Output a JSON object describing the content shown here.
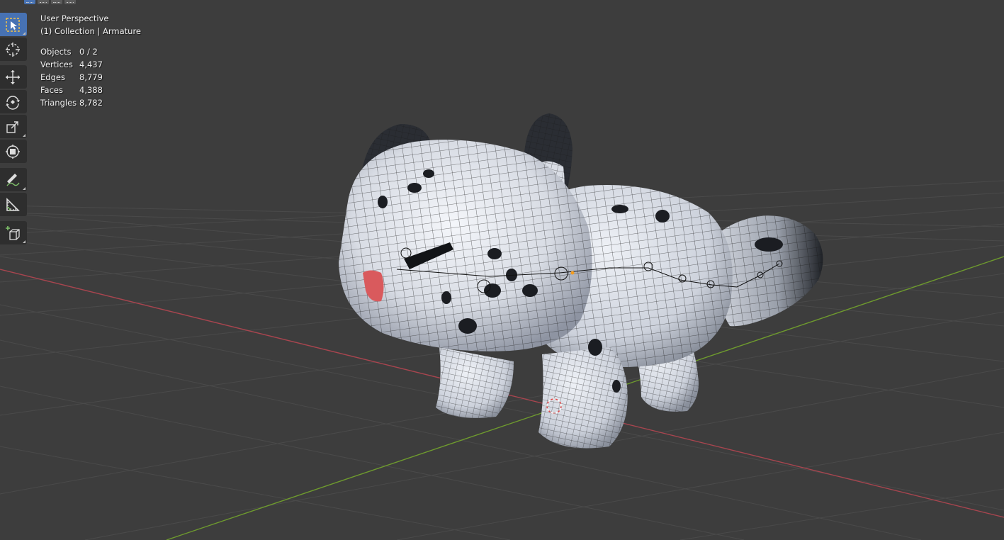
{
  "viewport": {
    "view_name": "User Perspective",
    "collection_info": "(1) Collection | Armature",
    "stats": [
      {
        "label": "Objects",
        "value": "0 / 2"
      },
      {
        "label": "Vertices",
        "value": "4,437"
      },
      {
        "label": "Edges",
        "value": "8,779"
      },
      {
        "label": "Faces",
        "value": "4,388"
      },
      {
        "label": "Triangles",
        "value": "8,782"
      }
    ]
  },
  "toolbar": {
    "tools": [
      {
        "name": "select-box",
        "icon": "select-box-icon",
        "active": true
      },
      {
        "name": "cursor",
        "icon": "cursor-icon",
        "active": false
      },
      {
        "name": "move",
        "icon": "move-icon",
        "active": false
      },
      {
        "name": "rotate",
        "icon": "rotate-icon",
        "active": false
      },
      {
        "name": "scale",
        "icon": "scale-icon",
        "active": false
      },
      {
        "name": "transform",
        "icon": "transform-icon",
        "active": false
      },
      {
        "name": "annotate",
        "icon": "annotate-icon",
        "active": false
      },
      {
        "name": "measure",
        "icon": "measure-icon",
        "active": false
      },
      {
        "name": "add-cube",
        "icon": "add-cube-icon",
        "active": false
      }
    ]
  },
  "colors": {
    "background": "#3d3d3d",
    "grid": "#4a4a4a",
    "x_axis": "#a8454f",
    "y_axis": "#6e9a2e",
    "active_tool": "#4772b3"
  }
}
